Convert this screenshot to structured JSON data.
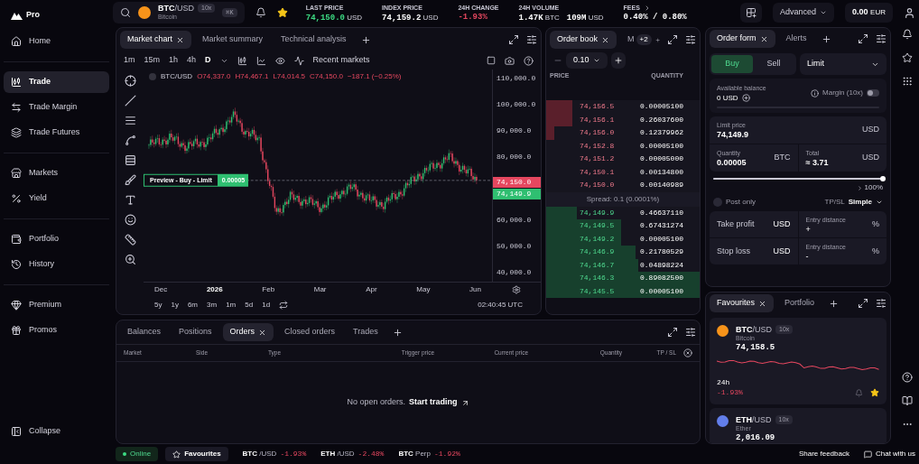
{
  "sidebar": {
    "logo": "Pro",
    "groups": [
      [
        {
          "label": "Home",
          "selected": false
        }
      ],
      [
        {
          "label": "Trade",
          "selected": true
        },
        {
          "label": "Trade Margin",
          "selected": false
        },
        {
          "label": "Trade Futures",
          "selected": false
        }
      ],
      [
        {
          "label": "Markets",
          "selected": false
        },
        {
          "label": "Yield",
          "selected": false
        }
      ],
      [
        {
          "label": "Portfolio",
          "selected": false
        },
        {
          "label": "History",
          "selected": false
        }
      ],
      [
        {
          "label": "Premium",
          "selected": false
        },
        {
          "label": "Promos",
          "selected": false
        }
      ]
    ],
    "collapse": "Collapse"
  },
  "top_bar": {
    "market": {
      "base": "BTC",
      "quote": "/USD",
      "leverage": "10x",
      "name": "Bitcoin",
      "shortcut": "⌘K",
      "favourite": true,
      "color": "#f7931a"
    },
    "stats": [
      {
        "label": "LAST PRICE",
        "color": "#3ddc84",
        "parts": [
          {
            "value": "74,150.0",
            "unit": "USD"
          }
        ]
      },
      {
        "label": "INDEX PRICE",
        "color": "#ffffff",
        "parts": [
          {
            "value": "74,159.2",
            "unit": "USD"
          }
        ]
      },
      {
        "label": "24H CHANGE",
        "color": "#e5475f",
        "parts": [
          {
            "value": "-1.93%"
          }
        ]
      },
      {
        "label": "24H VOLUME",
        "color": "#ffffff",
        "parts": [
          {
            "value": "1.47K",
            "unit": "BTC"
          },
          {
            "value": "109M",
            "unit": "USD"
          }
        ]
      },
      {
        "label": "FEES",
        "color": "#ffffff",
        "parts": [
          {
            "value": "0.40% / 0.80%"
          }
        ]
      }
    ],
    "mode": "Advanced",
    "balance": "0.00",
    "currency": "EUR"
  },
  "chart_panel": {
    "tabs": [
      {
        "label": "Market chart",
        "selected": true
      },
      {
        "label": "Market summary",
        "selected": false
      },
      {
        "label": "Technical analysis",
        "selected": false
      }
    ],
    "intervals": [
      {
        "label": "1m",
        "selected": false
      },
      {
        "label": "15m",
        "selected": false
      },
      {
        "label": "1h",
        "selected": false
      },
      {
        "label": "4h",
        "selected": false
      },
      {
        "label": "D",
        "selected": true
      }
    ],
    "recent_markets": "Recent markets",
    "legend": {
      "pair": "BTC/USD",
      "open": "O74,337.0",
      "high": "H74,467.1",
      "low": "L74,014.5",
      "close": "C74,150.0",
      "change": "−187.1 (−0.25%)"
    },
    "price_axis_upper": [
      "110,000.0",
      "100,000.0",
      "90,000.0",
      "80,000.0"
    ],
    "price_axis_lower": [
      "60,000.0",
      "50,000.0",
      "40,000.0"
    ],
    "ask_tag": "74,150.0",
    "bid_tag": "74,149.9",
    "order_preview": {
      "label": "Preview - Buy - Limit",
      "quantity": "0.00005"
    },
    "time_axis": [
      {
        "label": "Dec",
        "bold": false
      },
      {
        "label": "2026",
        "bold": true
      },
      {
        "label": "Feb",
        "bold": false
      },
      {
        "label": "Mar",
        "bold": false
      },
      {
        "label": "Apr",
        "bold": false
      },
      {
        "label": "May",
        "bold": false
      },
      {
        "label": "Jun",
        "bold": false
      }
    ],
    "ranges": [
      "5y",
      "1y",
      "6m",
      "3m",
      "1m",
      "5d",
      "1d"
    ],
    "clock": "02:40:45 UTC"
  },
  "order_book": {
    "tabs": [
      {
        "label": "Order book",
        "selected": true
      },
      {
        "label": "M",
        "selected": false
      }
    ],
    "more": "+2",
    "tick": "0.10",
    "headers": [
      "PRICE",
      "QUANTITY"
    ],
    "asks": [
      {
        "price": "74,156.5",
        "quantity": "0.00005100",
        "level": 0.17
      },
      {
        "price": "74,156.1",
        "quantity": "0.26037600",
        "level": 0.17
      },
      {
        "price": "74,156.0",
        "quantity": "0.12379962",
        "level": 0.05
      },
      {
        "price": "74,152.8",
        "quantity": "0.00005100",
        "level": 0
      },
      {
        "price": "74,151.2",
        "quantity": "0.00005000",
        "level": 0
      },
      {
        "price": "74,150.1",
        "quantity": "0.00134800",
        "level": 0
      },
      {
        "price": "74,150.0",
        "quantity": "0.00140989",
        "level": 0
      }
    ],
    "spread": "Spread: 0.1 (0.0001%)",
    "bids": [
      {
        "price": "74,149.9",
        "quantity": "0.46637110",
        "level": 0.2
      },
      {
        "price": "74,149.5",
        "quantity": "0.67431274",
        "level": 0.49
      },
      {
        "price": "74,149.2",
        "quantity": "0.00005100",
        "level": 0.49
      },
      {
        "price": "74,146.9",
        "quantity": "0.21780529",
        "level": 0.58
      },
      {
        "price": "74,146.7",
        "quantity": "0.04898224",
        "level": 0.6
      },
      {
        "price": "74,146.3",
        "quantity": "0.89082500",
        "level": 1
      },
      {
        "price": "74,145.5",
        "quantity": "0.00005100",
        "level": 1
      }
    ]
  },
  "order_form": {
    "tabs": [
      {
        "label": "Order form",
        "selected": true
      },
      {
        "label": "Alerts",
        "selected": false
      }
    ],
    "sides": [
      {
        "label": "Buy",
        "selected": true
      },
      {
        "label": "Sell",
        "selected": false
      }
    ],
    "order_type": "Limit",
    "balance_label": "Available balance",
    "balance": "0 USD",
    "margin": {
      "label": "Margin (10x)",
      "on": false
    },
    "limit_price": {
      "label": "Limit price",
      "value": "74,149.9",
      "unit": "USD"
    },
    "quantity": {
      "label": "Quantity",
      "value": "0.00005",
      "unit": "BTC"
    },
    "total": {
      "label": "Total",
      "value": "≈ 3.71",
      "unit": "USD"
    },
    "slider": {
      "level": 1,
      "reading": "100%"
    },
    "post_only": {
      "label": "Post only",
      "checked": false
    },
    "tpsl": {
      "label": "TP/SL",
      "mode": "Simple"
    },
    "protections": [
      {
        "label": "Take profit",
        "unit": "USD",
        "distance_label": "Entry distance",
        "sign": "+",
        "distance_unit": "%"
      },
      {
        "label": "Stop loss",
        "unit": "USD",
        "distance_label": "Entry distance",
        "sign": "-",
        "distance_unit": "%"
      }
    ]
  },
  "favourites_panel": {
    "tabs": [
      {
        "label": "Favourites",
        "selected": true
      },
      {
        "label": "Portfolio",
        "selected": false
      }
    ],
    "cards": [
      {
        "kind": "full",
        "base": "BTC",
        "quote": "/USD",
        "leverage": "10x",
        "name": "Bitcoin",
        "price": "74,158.5",
        "period": "24h",
        "change": "-1.93%",
        "favourite": true,
        "color": "#f7931a"
      },
      {
        "kind": "compact",
        "base": "ETH",
        "quote": "/USD",
        "leverage": "10x",
        "name": "Ether",
        "price": "2,016.09",
        "color": "#627eea"
      }
    ]
  },
  "orders_panel": {
    "tabs": [
      {
        "label": "Balances",
        "selected": false
      },
      {
        "label": "Positions",
        "selected": false
      },
      {
        "label": "Orders",
        "selected": true
      },
      {
        "label": "Closed orders",
        "selected": false
      },
      {
        "label": "Trades",
        "selected": false
      }
    ],
    "columns": [
      "Market",
      "Side",
      "Type",
      "Trigger price",
      "Current price",
      "Quantity",
      "TP / SL"
    ],
    "empty_text": "No open orders.",
    "empty_link": "Start trading"
  },
  "footer": {
    "status": {
      "label": "Online",
      "online": true
    },
    "favourites": "Favourites",
    "tickers": [
      {
        "base": "BTC",
        "quote": "/USD",
        "change": "-1.93%"
      },
      {
        "base": "ETH",
        "quote": "/USD",
        "change": "-2.48%"
      },
      {
        "base": "BTC",
        "quote": "Perp",
        "change": "-1.92%"
      }
    ],
    "feedback": "Share feedback",
    "chat": "Chat with us"
  }
}
